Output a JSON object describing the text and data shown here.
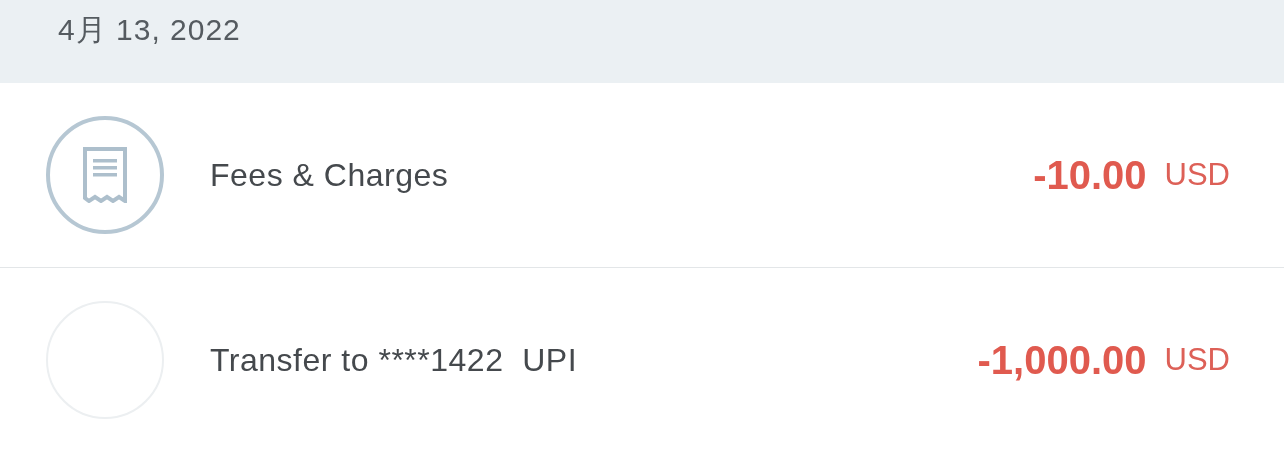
{
  "date_header": "4月 13, 2022",
  "transactions": [
    {
      "kind": "receipt",
      "title": "Fees & Charges",
      "amount": "-10.00",
      "currency": "USD"
    },
    {
      "kind": "blank",
      "title": "Transfer to ****1422  UPI",
      "amount": "-1,000.00",
      "currency": "USD"
    }
  ]
}
